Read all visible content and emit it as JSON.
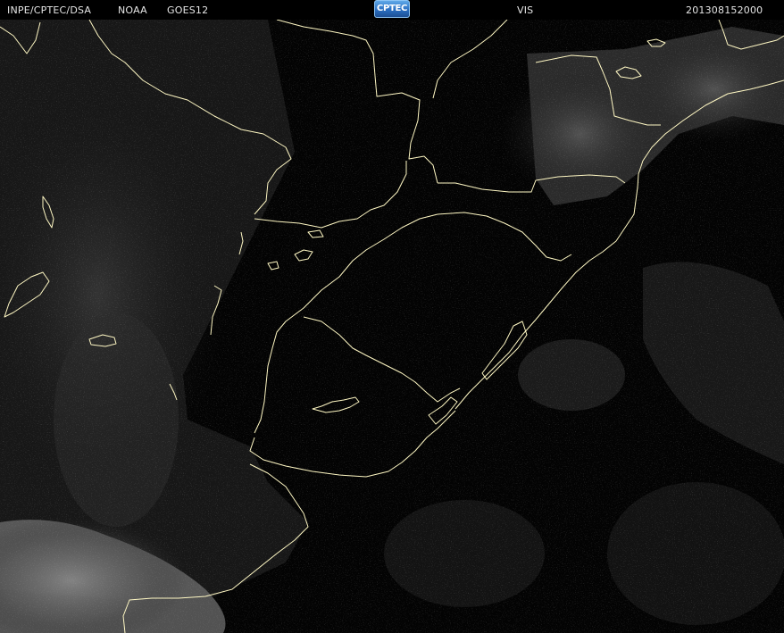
{
  "header": {
    "organization": "INPE/CPTEC/DSA",
    "agency": "NOAA",
    "satellite": "GOES12",
    "channel": "VIS",
    "timestamp": "201308152000"
  },
  "logo": {
    "text": "CPTEC"
  },
  "imagery": {
    "band": "visible",
    "boundary_color": "#fff8c4"
  }
}
